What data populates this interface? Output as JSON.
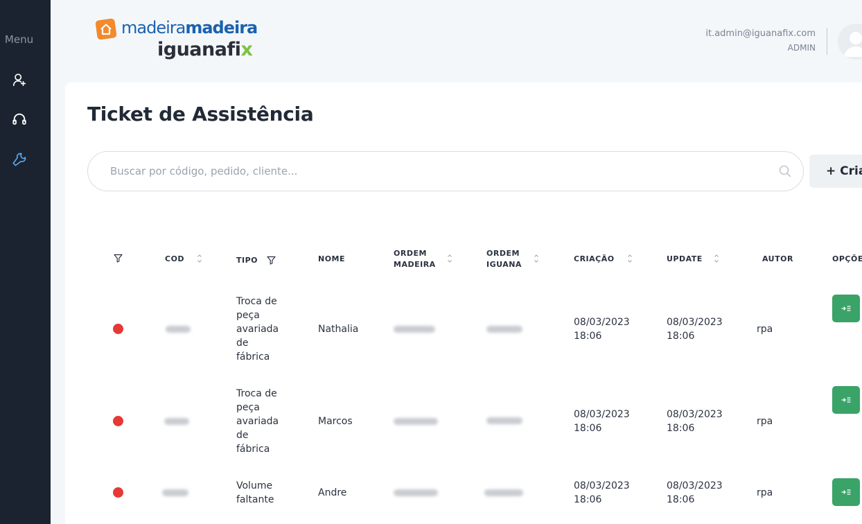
{
  "sidebar": {
    "menu_label": "Menu",
    "items": [
      {
        "icon": "user-add-icon",
        "label": "users"
      },
      {
        "icon": "headset-icon",
        "label": "support"
      },
      {
        "icon": "wrench-icon",
        "label": "assistance"
      }
    ]
  },
  "header": {
    "logo_part1": "madeira",
    "logo_part2": "madeira",
    "logo_sub": "iguanafi",
    "logo_sub_x": "x",
    "user_email": "it.admin@iguanafix.com",
    "user_role": "ADMIN"
  },
  "main": {
    "title": "Ticket de Assistência",
    "search_placeholder": "Buscar por código, pedido, cliente...",
    "create_button": "+ Cria"
  },
  "table": {
    "headers": {
      "cod": "COD",
      "tipo": "TIPO",
      "nome": "NOME",
      "ordem_madeira_1": "ORDEM",
      "ordem_madeira_2": "MADEIRA",
      "ordem_iguana_1": "ORDEM",
      "ordem_iguana_2": "IGUANA",
      "criacao": "CRIAÇÃO",
      "update": "UPDATE",
      "autor": "AUTOR",
      "opcoes": "OPÇÕES"
    },
    "rows": [
      {
        "tipo_lines": [
          "Troca de",
          "peça",
          "avariada",
          "de",
          "fábrica"
        ],
        "nome": "Nathalia",
        "criacao_date": "08/03/2023",
        "criacao_time": "18:06",
        "update_date": "08/03/2023",
        "update_time": "18:06",
        "autor": "rpa"
      },
      {
        "tipo_lines": [
          "Troca de",
          "peça",
          "avariada",
          "de",
          "fábrica"
        ],
        "nome": "Marcos",
        "criacao_date": "08/03/2023",
        "criacao_time": "18:06",
        "update_date": "08/03/2023",
        "update_time": "18:06",
        "autor": "rpa"
      },
      {
        "tipo_lines": [
          "Volume",
          "faltante"
        ],
        "nome": "Andre",
        "criacao_date": "08/03/2023",
        "criacao_time": "18:06",
        "update_date": "08/03/2023",
        "update_time": "18:06",
        "autor": "rpa"
      }
    ]
  },
  "colors": {
    "sidebar_bg": "#1c2330",
    "status_red": "#e53935",
    "action_green": "#3aa368",
    "brand_blue": "#1a62b0",
    "brand_orange": "#f28a2e",
    "brand_green": "#7dc242"
  }
}
